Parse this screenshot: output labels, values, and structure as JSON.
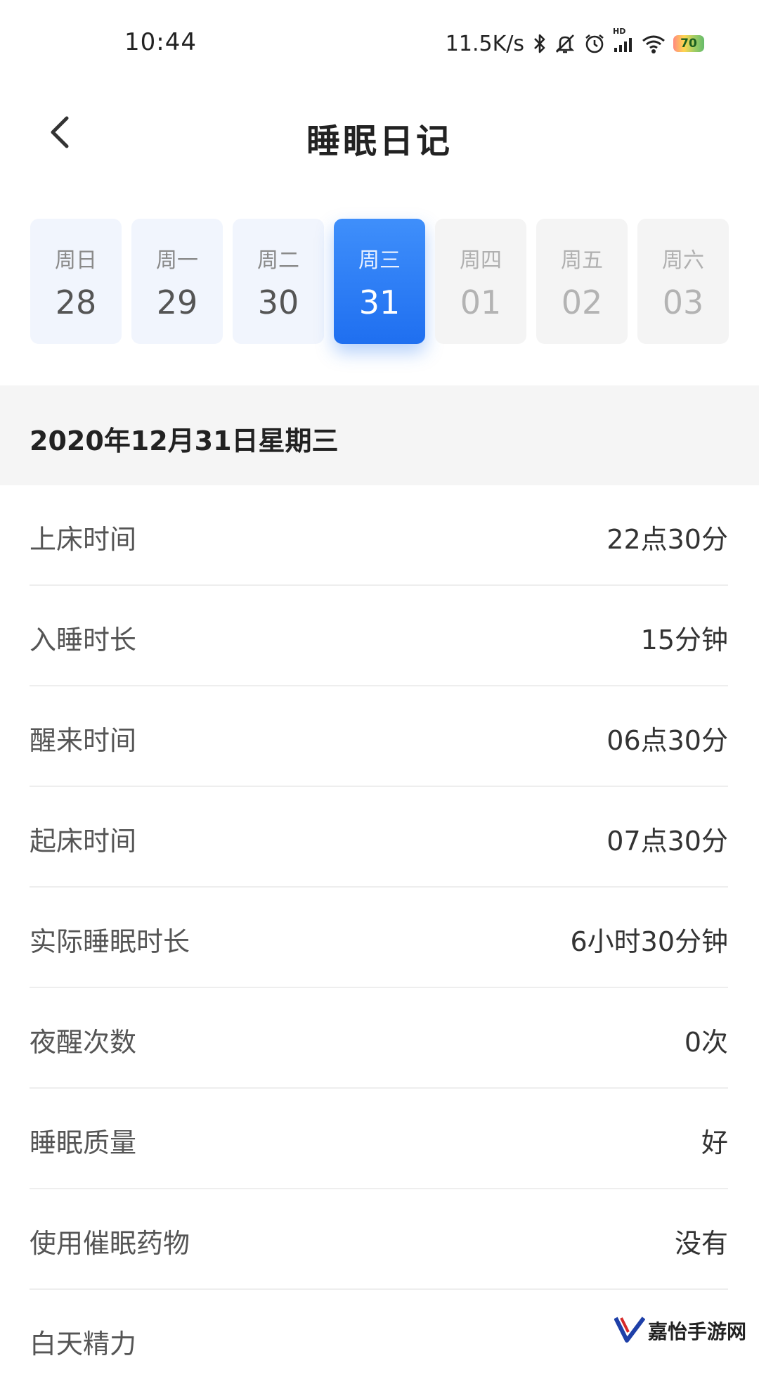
{
  "status_bar": {
    "time": "10:44",
    "net_speed": "11.5K/s",
    "network_badge": "HD",
    "battery_level": "70",
    "icons": [
      "bluetooth-icon",
      "mute-icon",
      "alarm-icon",
      "signal-icon",
      "wifi-icon",
      "battery-icon"
    ]
  },
  "header": {
    "back_icon": "chevron-left-icon",
    "title": "睡眠日记"
  },
  "week": {
    "days": [
      {
        "weekday": "周日",
        "date": "28",
        "state": "past"
      },
      {
        "weekday": "周一",
        "date": "29",
        "state": "past"
      },
      {
        "weekday": "周二",
        "date": "30",
        "state": "past"
      },
      {
        "weekday": "周三",
        "date": "31",
        "state": "selected"
      },
      {
        "weekday": "周四",
        "date": "01",
        "state": "future"
      },
      {
        "weekday": "周五",
        "date": "02",
        "state": "future"
      },
      {
        "weekday": "周六",
        "date": "03",
        "state": "future"
      }
    ],
    "accent_color": "#2a7cf6"
  },
  "selected_date": "2020年12月31日星期三",
  "records": [
    {
      "label": "上床时间",
      "value": "22点30分"
    },
    {
      "label": "入睡时长",
      "value": "15分钟"
    },
    {
      "label": "醒来时间",
      "value": "06点30分"
    },
    {
      "label": "起床时间",
      "value": "07点30分"
    },
    {
      "label": "实际睡眠时长",
      "value": "6小时30分钟"
    },
    {
      "label": "夜醒次数",
      "value": "0次"
    },
    {
      "label": "睡眠质量",
      "value": "好"
    },
    {
      "label": "使用催眠药物",
      "value": "没有"
    },
    {
      "label": "白天精力",
      "value": ""
    }
  ],
  "watermark": {
    "text": "嘉怡手游网",
    "logo_icon": "v-logo-icon"
  }
}
